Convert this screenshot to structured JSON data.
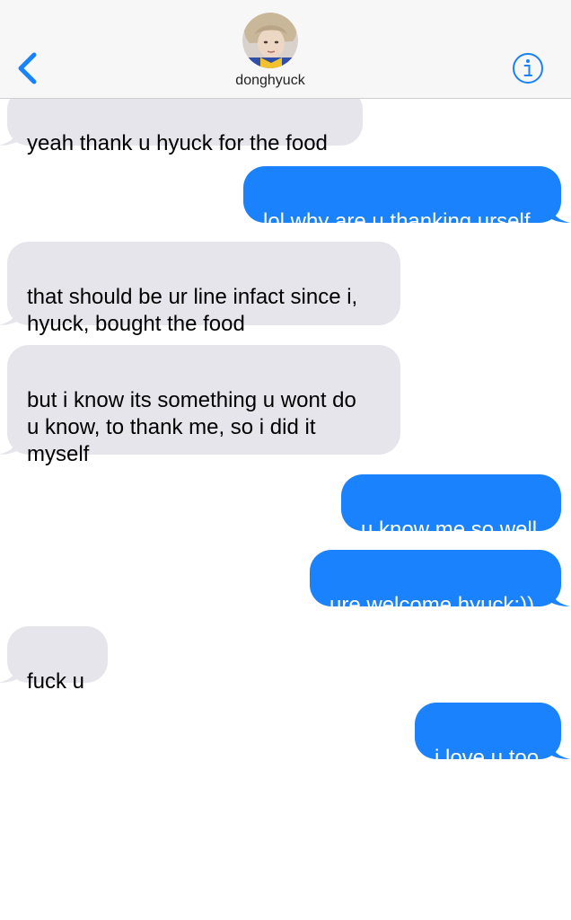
{
  "header": {
    "contact_name": "donghyuck",
    "back_icon": "chevron-left-icon",
    "info_icon": "info-icon",
    "accent_color": "#1982fc"
  },
  "messages": [
    {
      "direction": "received",
      "text": "yeah thank u hyuck for the food"
    },
    {
      "direction": "sent",
      "text": "lol why are u thanking urself"
    },
    {
      "direction": "received",
      "text": "that should be ur line infact since i,\nhyuck, bought the food"
    },
    {
      "direction": "received",
      "text": "but i know its something u wont do\nu know, to thank me, so i did it\nmyself"
    },
    {
      "direction": "sent",
      "text": "u know me so well"
    },
    {
      "direction": "sent",
      "text": "ure welcome hyuck:))"
    },
    {
      "direction": "received",
      "text": "fuck u"
    },
    {
      "direction": "sent",
      "text": "i love u too"
    }
  ],
  "colors": {
    "sent_bubble": "#1982fc",
    "received_bubble": "#e6e5eb",
    "header_bg": "#f7f7f7"
  }
}
